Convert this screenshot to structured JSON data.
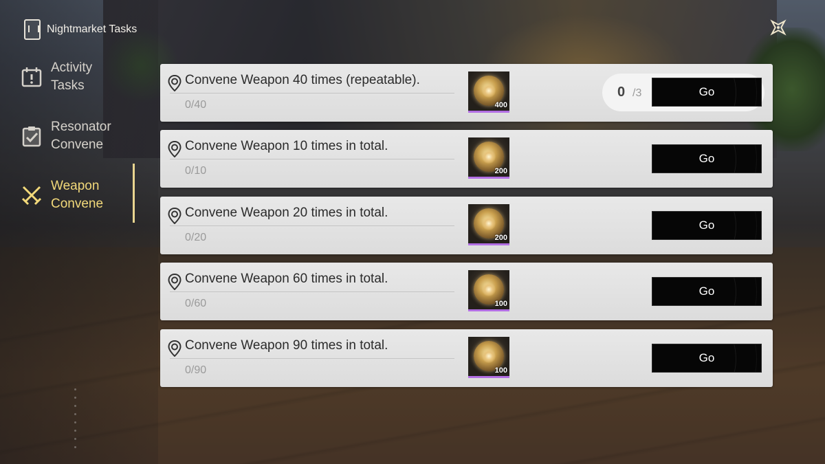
{
  "header": {
    "title": "Nightmarket Tasks",
    "icon": "task-book-icon"
  },
  "close": {
    "icon": "close-star-icon"
  },
  "sidebar": {
    "items": [
      {
        "label": "Activity Tasks",
        "icon": "calendar-alert-icon",
        "active": false
      },
      {
        "label": "Resonator Convene",
        "icon": "clipboard-check-icon",
        "active": false
      },
      {
        "label": "Weapon Convene",
        "icon": "crossed-swords-icon",
        "active": true
      }
    ]
  },
  "colors": {
    "active_accent": "#f2d97a",
    "reward_border": "#b26ee3",
    "card_bg": "#e2e2e2"
  },
  "tasks": [
    {
      "name": "Convene Weapon 40 times (repeatable).",
      "progress": "0/40",
      "reward_qty": "400",
      "counter_current": "0",
      "counter_max": "/3",
      "button": "Go"
    },
    {
      "name": "Convene Weapon 10 times in total.",
      "progress": "0/10",
      "reward_qty": "200",
      "button": "Go"
    },
    {
      "name": "Convene Weapon 20 times in total.",
      "progress": "0/20",
      "reward_qty": "200",
      "button": "Go"
    },
    {
      "name": "Convene Weapon 60 times in total.",
      "progress": "0/60",
      "reward_qty": "100",
      "button": "Go"
    },
    {
      "name": "Convene Weapon 90 times in total.",
      "progress": "0/90",
      "reward_qty": "100",
      "button": "Go"
    }
  ]
}
